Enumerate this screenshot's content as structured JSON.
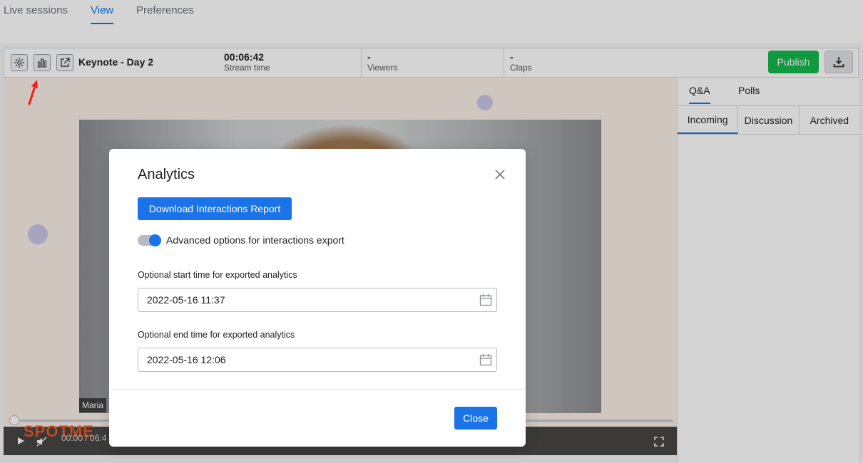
{
  "top_tabs": [
    {
      "label": "Live sessions"
    },
    {
      "label": "View"
    },
    {
      "label": "Preferences"
    }
  ],
  "session_bar": {
    "title": "Keynote - Day 2",
    "stream_time": {
      "value": "00:06:42",
      "label": "Stream time"
    },
    "viewers": {
      "value": "-",
      "label": "Viewers"
    },
    "claps": {
      "value": "-",
      "label": "Claps"
    },
    "publish_label": "Publish"
  },
  "video": {
    "speaker_name": "Maria",
    "logo_text": "SPOTME",
    "time_readout": "00:00 / 06:4"
  },
  "right_panel": {
    "tabs": [
      {
        "label": "Q&A"
      },
      {
        "label": "Polls"
      }
    ],
    "subtabs": [
      {
        "label": "Incoming"
      },
      {
        "label": "Discussion"
      },
      {
        "label": "Archived"
      }
    ]
  },
  "modal": {
    "title": "Analytics",
    "download_label": "Download Interactions Report",
    "toggle_label": "Advanced options for interactions export",
    "toggle_on": true,
    "start_label": "Optional start time for exported analytics",
    "start_value": "2022-05-16 11:37",
    "end_label": "Optional end time for exported analytics",
    "end_value": "2022-05-16 12:06",
    "close_label": "Close"
  },
  "colors": {
    "accent": "#1a73e8",
    "publish": "#14b84b",
    "annotation_arrow": "#ff1a1a"
  },
  "icons": [
    "gear-icon",
    "bar-chart-icon",
    "external-link-icon",
    "download-icon",
    "close-icon",
    "calendar-icon",
    "play-icon",
    "mute-icon",
    "fullscreen-icon"
  ]
}
